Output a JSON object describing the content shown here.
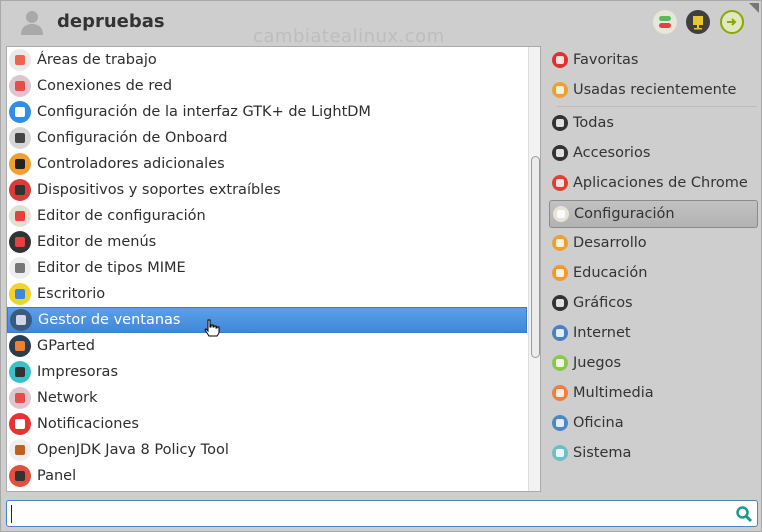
{
  "header": {
    "username": "depruebas",
    "watermark": "cambiatealinux.com",
    "buttons": [
      {
        "name": "settings-manager",
        "icon": "toggle-icon",
        "color": "#e8e6da"
      },
      {
        "name": "lock-screen",
        "icon": "lock-icon",
        "color": "#3f3f3f"
      },
      {
        "name": "log-out",
        "icon": "logout-icon",
        "color": "#8da600"
      }
    ]
  },
  "apps": [
    {
      "label": "Áreas de trabajo",
      "color": "#e9e9e9",
      "accent": "#ef6450"
    },
    {
      "label": "Conexiones de red",
      "color": "#dcc7d0",
      "accent": "#e84c4c"
    },
    {
      "label": "Configuración de la interfaz GTK+ de LightDM",
      "color": "#2f8ee8",
      "accent": "#ffffff"
    },
    {
      "label": "Configuración de Onboard",
      "color": "#d6d6d6",
      "accent": "#444444"
    },
    {
      "label": "Controladores adicionales",
      "color": "#f0a030",
      "accent": "#222222"
    },
    {
      "label": "Dispositivos y soportes extraíbles",
      "color": "#d93a3a",
      "accent": "#333333"
    },
    {
      "label": "Editor de configuración",
      "color": "#e0e0d4",
      "accent": "#e84040"
    },
    {
      "label": "Editor de menús",
      "color": "#333333",
      "accent": "#e84040"
    },
    {
      "label": "Editor de tipos MIME",
      "color": "#eeeeee",
      "accent": "#777777"
    },
    {
      "label": "Escritorio",
      "color": "#f2d22c",
      "accent": "#3a8ad8"
    },
    {
      "label": "Gestor de ventanas",
      "color": "#3c5a80",
      "accent": "#cfd8e4"
    },
    {
      "label": "GParted",
      "color": "#2c3e4c",
      "accent": "#f08030"
    },
    {
      "label": "Impresoras",
      "color": "#3cc0c8",
      "accent": "#333333"
    },
    {
      "label": "Network",
      "color": "#dcc7d0",
      "accent": "#e84c4c"
    },
    {
      "label": "Notificaciones",
      "color": "#e63232",
      "accent": "#ffffff"
    },
    {
      "label": "OpenJDK Java 8 Policy Tool",
      "color": "#eeeeee",
      "accent": "#c06020"
    },
    {
      "label": "Panel",
      "color": "#e05040",
      "accent": "#333333"
    }
  ],
  "selected_app": "Gestor de ventanas",
  "categories": [
    {
      "label": "Favoritas",
      "icon": "bookmark-icon",
      "color": "#e03030"
    },
    {
      "label": "Usadas recientemente",
      "icon": "recent-icon",
      "color": "#f0a030"
    },
    {
      "label": "Todas",
      "icon": "all-apps-icon",
      "color": "#333333"
    },
    {
      "label": "Accesorios",
      "icon": "accessories-icon",
      "color": "#333333"
    },
    {
      "label": "Aplicaciones de Chrome",
      "icon": "chrome-icon",
      "color": "#e04030"
    },
    {
      "label": "Configuración",
      "icon": "settings-icon",
      "color": "#e6e4d8"
    },
    {
      "label": "Desarrollo",
      "icon": "development-icon",
      "color": "#f0a030"
    },
    {
      "label": "Educación",
      "icon": "education-icon",
      "color": "#f09a30"
    },
    {
      "label": "Gráficos",
      "icon": "graphics-icon",
      "color": "#333333"
    },
    {
      "label": "Internet",
      "icon": "internet-icon",
      "color": "#4a80c8"
    },
    {
      "label": "Juegos",
      "icon": "games-icon",
      "color": "#8cc84a"
    },
    {
      "label": "Multimedia",
      "icon": "multimedia-icon",
      "color": "#f08040"
    },
    {
      "label": "Oficina",
      "icon": "office-icon",
      "color": "#4a88c8"
    },
    {
      "label": "Sistema",
      "icon": "system-icon",
      "color": "#6cc0c8"
    }
  ],
  "selected_category": "Configuración",
  "search": {
    "value": "",
    "placeholder": ""
  },
  "colors": {
    "selection": "#4a90d9",
    "search_border": "#4a84c4",
    "search_icon": "#1a9a8a"
  }
}
